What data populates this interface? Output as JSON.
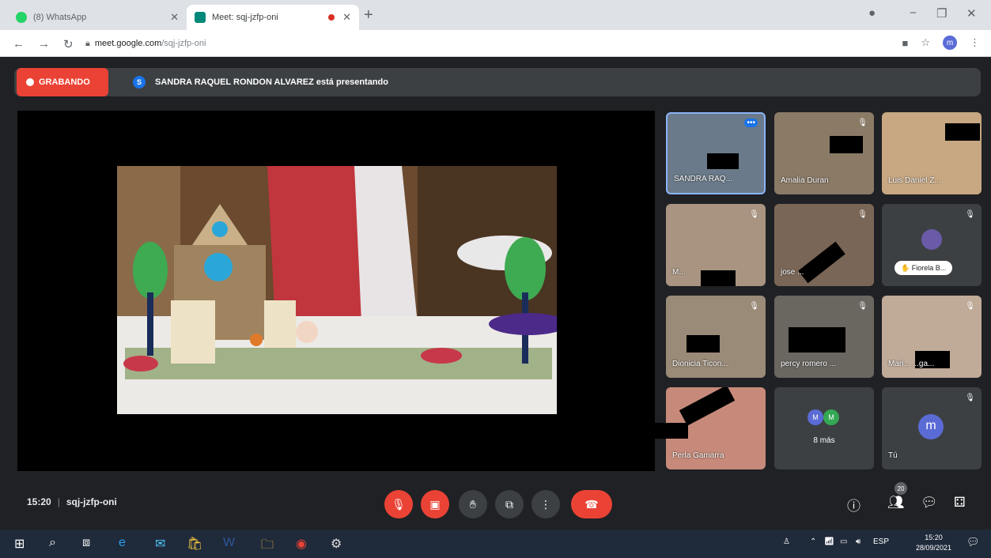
{
  "browser": {
    "tabs": [
      {
        "title": "(8) WhatsApp",
        "favicon_color": "#25d366",
        "recording": false
      },
      {
        "title": "Meet: sqj-jzfp-oni",
        "favicon_color": "#00897b",
        "recording": true
      }
    ],
    "new_tab": "+",
    "url_host": "meet.google.com",
    "url_path": "/sqj-jzfp-oni",
    "profile_initial": "m"
  },
  "meet": {
    "recording_label": "GRABANDO",
    "presenter_initial": "S",
    "presenting_text": "SANDRA RAQUEL RONDON ALVAREZ está presentando",
    "participants": [
      {
        "name": "SANDRA RAQ...",
        "active": true,
        "muted": false
      },
      {
        "name": "Amalia Duran",
        "active": false,
        "muted": true
      },
      {
        "name": "Luis Daniel Z...",
        "active": false,
        "muted": false
      },
      {
        "name": "M...",
        "active": false,
        "muted": true
      },
      {
        "name": "jose ...",
        "active": false,
        "muted": true
      },
      {
        "name": "Fiorela B...",
        "active": false,
        "muted": true
      },
      {
        "name": "Dionicia Ticon...",
        "active": false,
        "muted": true
      },
      {
        "name": "percy romero ...",
        "active": false,
        "muted": true
      },
      {
        "name": "Mari... ...ga...",
        "active": false,
        "muted": true
      },
      {
        "name": "Perla Gamarra",
        "active": false,
        "muted": false
      }
    ],
    "more": {
      "label": "8 más",
      "initials": [
        "M",
        "M"
      ]
    },
    "self": {
      "label": "Tú",
      "initial": "m"
    },
    "time": "15:20",
    "separator": "|",
    "meeting_code": "sqj-jzfp-oni",
    "participant_count": "20",
    "colors": {
      "danger": "#ea4335",
      "surface": "#3c4043",
      "background": "#202124"
    }
  },
  "taskbar": {
    "lang": "ESP",
    "time": "15:20",
    "date": "28/09/2021"
  }
}
